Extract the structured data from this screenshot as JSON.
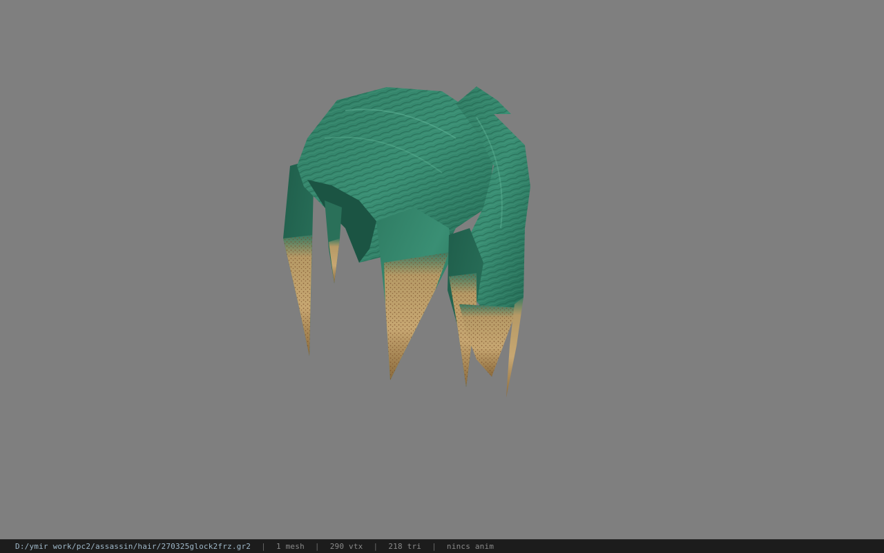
{
  "viewer": {
    "background_color": "#7f7f7f",
    "model_subject": "hair mesh",
    "hair_color": "#2e7a62",
    "tip_color": "#c7a772"
  },
  "status": {
    "file_path": "D:/ymir work/pc2/assassin/hair/270325glock2frz.gr2",
    "separator": "|",
    "mesh_count": "1 mesh",
    "vertex_count": "290 vtx",
    "triangle_count": "218 tri",
    "animation": "nincs anim"
  }
}
